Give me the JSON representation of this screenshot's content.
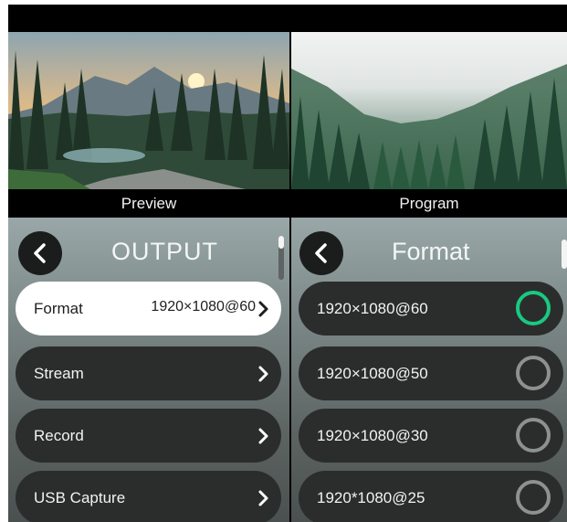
{
  "preview": {
    "caption": "Preview"
  },
  "program": {
    "caption": "Program"
  },
  "output_panel": {
    "title": "OUTPUT",
    "items": [
      {
        "label": "Format",
        "value": "1920×1080@60",
        "selected": true
      },
      {
        "label": "Stream",
        "value": ""
      },
      {
        "label": "Record",
        "value": ""
      },
      {
        "label": "USB Capture",
        "value": ""
      }
    ]
  },
  "format_panel": {
    "title": "Format",
    "options": [
      {
        "label": "1920×1080@60",
        "selected": true
      },
      {
        "label": "1920×1080@50",
        "selected": false
      },
      {
        "label": "1920×1080@30",
        "selected": false
      },
      {
        "label": "1920*1080@25",
        "selected": false
      }
    ]
  },
  "icons": {
    "back": "chevron-left-icon",
    "forward": "chevron-right-icon",
    "radio_on": "radio-selected-icon",
    "radio_off": "radio-unselected-icon"
  },
  "colors": {
    "selected_radio": "#19c982",
    "unselected_radio": "#8d9192",
    "item_bg": "#2b2d2d",
    "selected_item_bg": "#ffffff"
  }
}
